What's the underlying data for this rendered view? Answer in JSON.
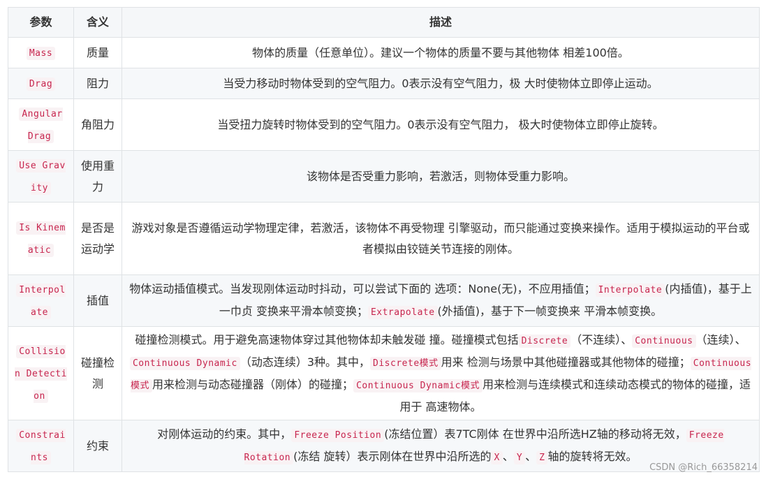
{
  "headers": [
    "参数",
    "含义",
    "描述"
  ],
  "rows": [
    {
      "param": "Mass",
      "meaning": "质量",
      "desc": [
        {
          "t": "物体的质量（任意单位）。建议一个物体的质量不要与其他物体 相差100倍。"
        }
      ]
    },
    {
      "param": "Drag",
      "meaning": "阻力",
      "desc": [
        {
          "t": "当受力移动时物体受到的空气阻力。0表示没有空气阻力，极 大时使物体立即停止运动。"
        }
      ]
    },
    {
      "param": "Angular Drag",
      "meaning": "角阻力",
      "desc": [
        {
          "t": "当受扭力旋转时物体受到的空气阻力。0表示没有空气阻力， 极大时使物体立即停止旋转。"
        }
      ]
    },
    {
      "param": "Use Gravity",
      "meaning": "使用重力",
      "desc": [
        {
          "t": "该物体是否受重力影响，若激活，则物体受重力影响。"
        }
      ]
    },
    {
      "param": "Is Kinematic",
      "meaning": "是否是运动学",
      "desc": [
        {
          "t": "游戏对象是否遵循运动学物理定律，若激活，该物体不再受物理 引擎驱动，而只能通过变换来操作。适用于模拟运动的平台或 者模拟由铰链关节连接的刚体。"
        }
      ]
    },
    {
      "param": "Interpolate",
      "meaning": "插值",
      "desc": [
        {
          "t": "物体运动插值模式。当发现刚体运动时抖动，可以尝试下面的 选项：None(无)，不应用插值；"
        },
        {
          "c": "Interpolate"
        },
        {
          "t": "(内插值)，基于上一巾贞 变换来平滑本帧变换；"
        },
        {
          "c": "Extrapolate"
        },
        {
          "t": "(外插值)，基于下一帧变换来 平滑本帧变换。"
        }
      ]
    },
    {
      "param": "Collision Detection",
      "meaning": "碰撞检测",
      "desc": [
        {
          "t": "碰撞检测模式。用于避免高速物体穿过其他物体却未触发碰 撞。碰撞模式包括"
        },
        {
          "c": "Discrete"
        },
        {
          "t": "（不连续）、"
        },
        {
          "c": "Continuous"
        },
        {
          "t": "（连续）、"
        },
        {
          "c": "Continuous Dynamic"
        },
        {
          "t": "（动态连续）3种。其中，"
        },
        {
          "c": "Discrete模式"
        },
        {
          "t": "用来 检测与场景中其他碰撞器或其他物体的碰撞；"
        },
        {
          "c": "Continuous模式"
        },
        {
          "t": "用来检测与动态碰撞器（刚体）的碰撞；"
        },
        {
          "c": "Continuous Dynamic模式"
        },
        {
          "t": "用来检测与连续模式和连续动态模式的物体的碰撞，适用于 高速物体。"
        }
      ]
    },
    {
      "param": "Constraints",
      "meaning": "约束",
      "desc": [
        {
          "t": "对刚体运动的约束。其中，"
        },
        {
          "c": "Freeze Position"
        },
        {
          "t": "(冻结位置）表7TC刚体 在世界中沿所选HZ轴的移动将无效，"
        },
        {
          "c": "Freeze Rotation"
        },
        {
          "t": "(冻结 旋转）表示刚体在世界中沿所选的"
        },
        {
          "c": "X"
        },
        {
          "t": "、"
        },
        {
          "c": "Y"
        },
        {
          "t": "、"
        },
        {
          "c": "Z"
        },
        {
          "t": "轴的旋转将无效。"
        }
      ]
    }
  ],
  "watermark": "CSDN @Rich_66358214"
}
